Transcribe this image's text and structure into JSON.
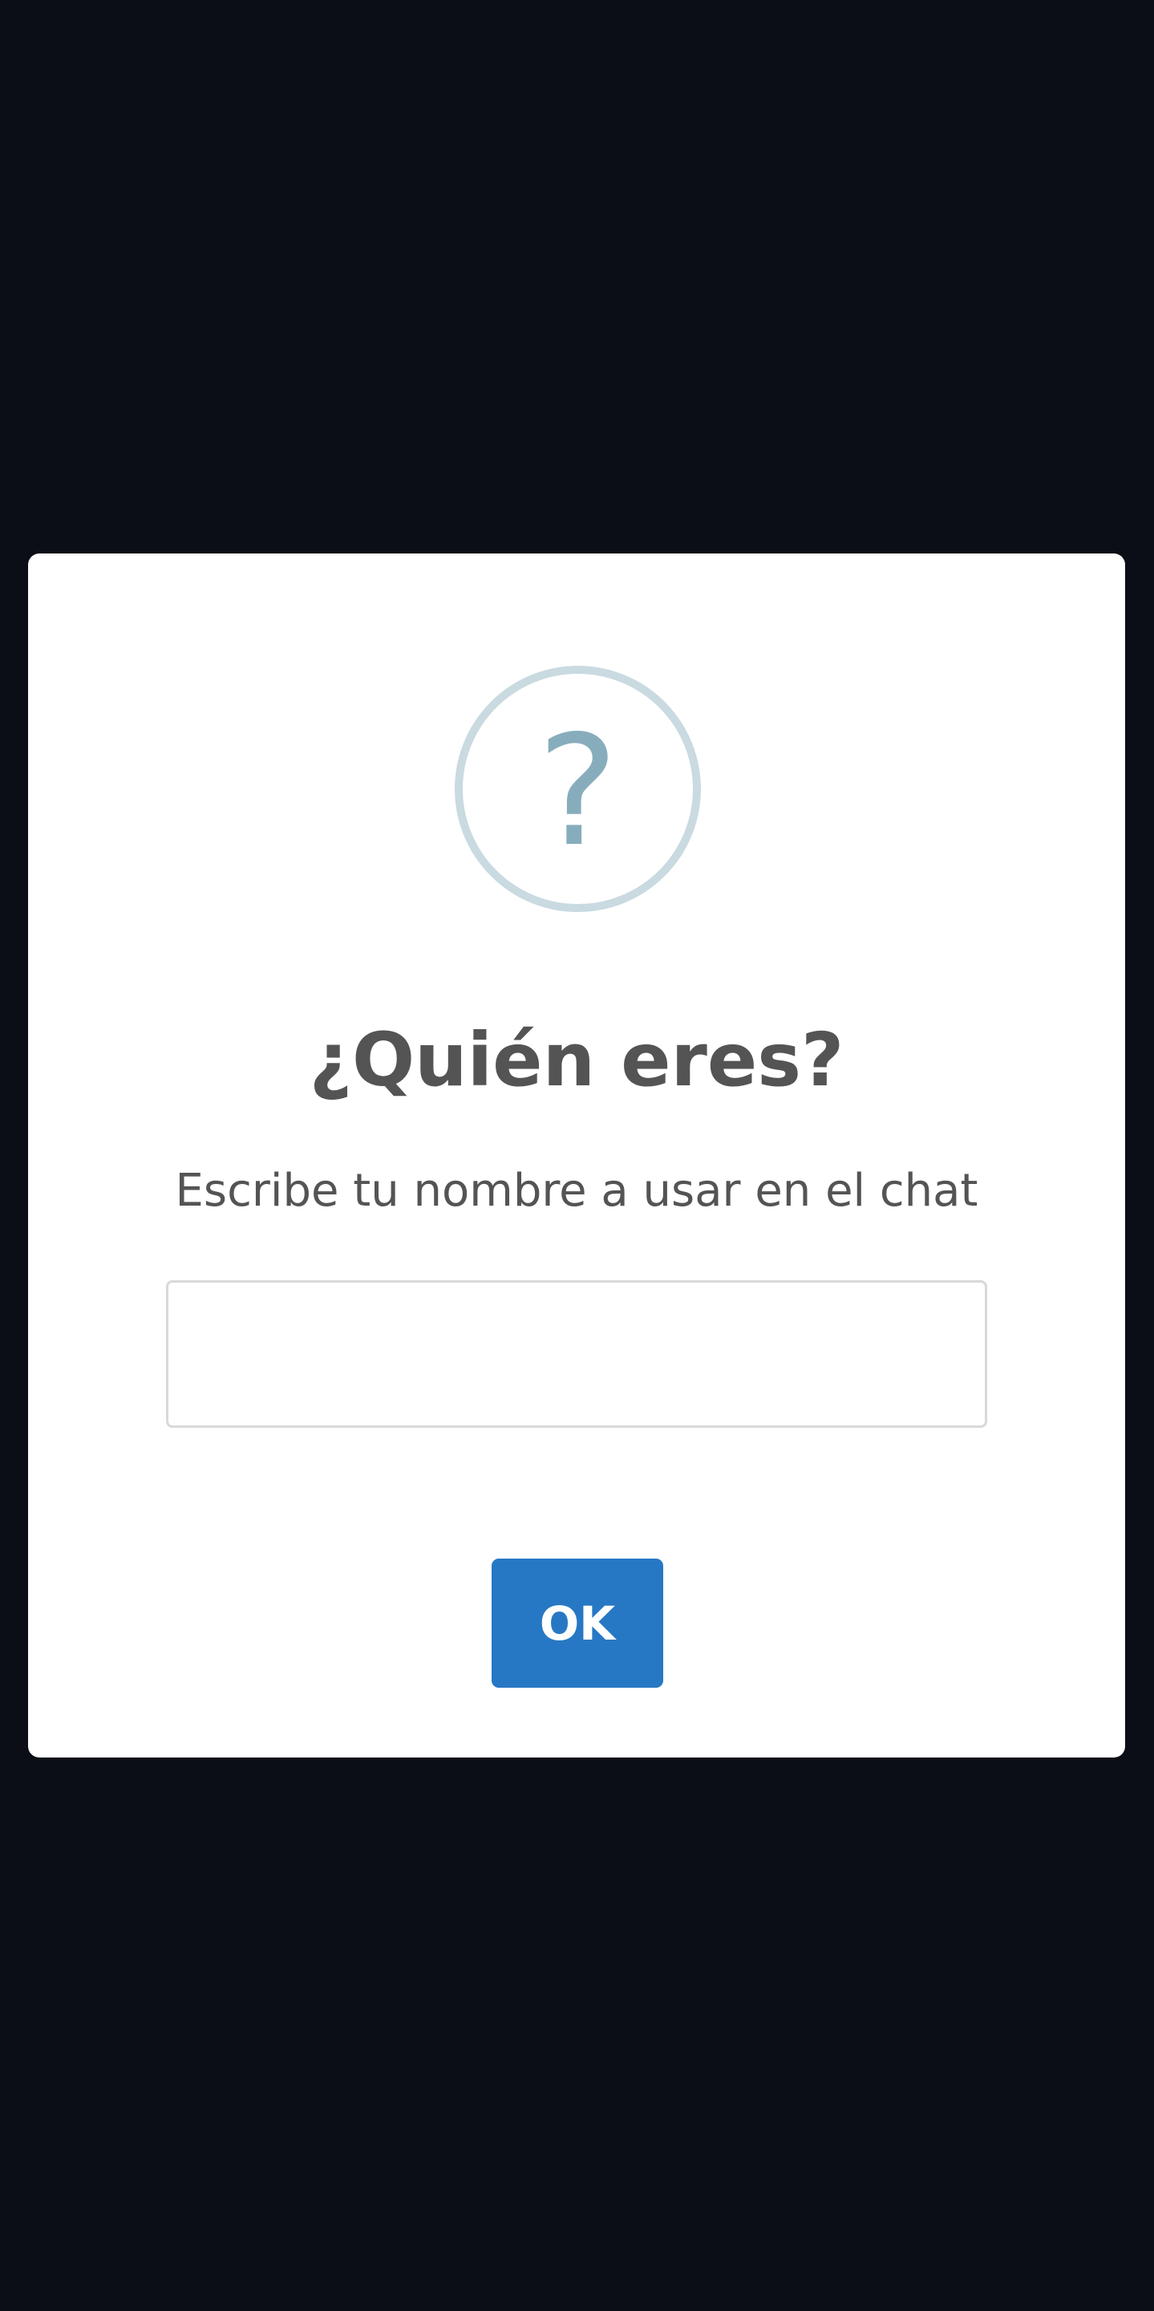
{
  "dialog": {
    "icon": "question-icon",
    "icon_glyph": "?",
    "title": "¿Quién eres?",
    "message": "Escribe tu nombre a usar en el chat",
    "input": {
      "value": "",
      "placeholder": ""
    },
    "confirm_label": "OK"
  },
  "colors": {
    "backdrop": "#0b0e16",
    "dialog_background": "#ffffff",
    "icon_ring": "#c9dae1",
    "icon_glyph": "#87adbd",
    "text": "#545454",
    "confirm_button": "#2778c4"
  }
}
